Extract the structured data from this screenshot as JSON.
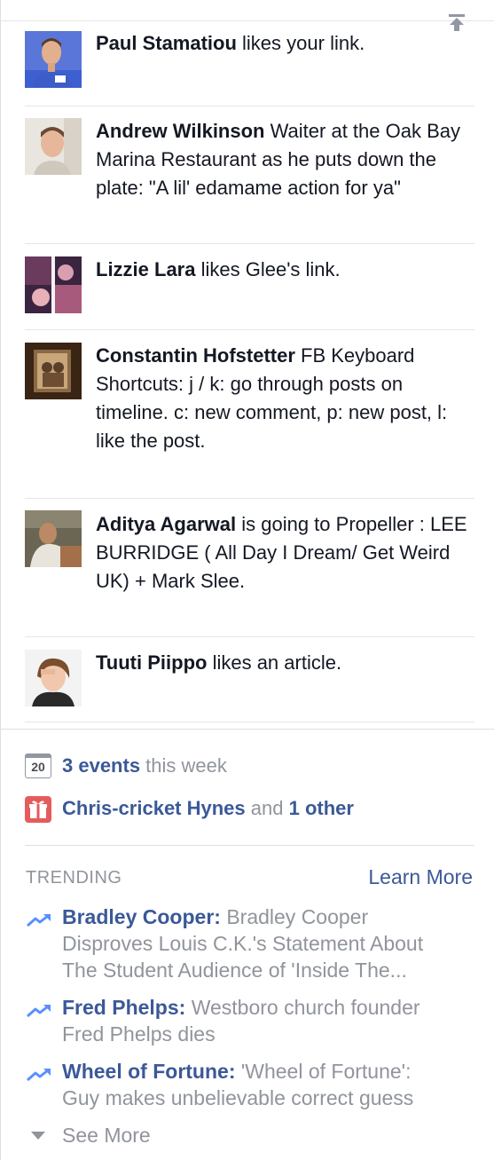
{
  "ticker": {
    "stories": [
      {
        "name": "Paul Stamatiou",
        "text": " likes your link."
      },
      {
        "name": "Andrew Wilkinson",
        "text": " Waiter at the Oak Bay Marina Restaurant as he puts down the plate: \"A lil' edamame action for ya\""
      },
      {
        "name": "Lizzie Lara",
        "text": " likes Glee's link."
      },
      {
        "name": "Constantin Hofstetter",
        "text": " FB Keyboard Shortcuts: j / k: go through posts on timeline. c: new comment, p: new post, l: like the post."
      },
      {
        "name": "Aditya Agarwal",
        "text": " is going to Propeller : LEE BURRIDGE ( All Day I Dream/ Get Weird UK) + Mark Slee."
      },
      {
        "name": "Tuuti Piippo",
        "text": " likes an article."
      }
    ]
  },
  "reminders": {
    "events": {
      "calendar_day": "20",
      "count": "3 events",
      "suffix": " this week"
    },
    "birthday": {
      "name": "Chris-cricket Hynes",
      "and": " and ",
      "other": "1 other"
    }
  },
  "trending": {
    "title": "TRENDING",
    "learn_more": "Learn More",
    "items": [
      {
        "topic": "Bradley Cooper:",
        "text": " Bradley Cooper Disproves Louis C.K.'s Statement About The Student Audience of 'Inside The..."
      },
      {
        "topic": "Fred Phelps:",
        "text": " Westboro church founder Fred Phelps dies"
      },
      {
        "topic": "Wheel of Fortune:",
        "text": " 'Wheel of Fortune': Guy makes unbelievable correct guess"
      }
    ],
    "see_more": "See More"
  },
  "colors": {
    "link": "#3b5998",
    "muted": "#90949c",
    "text": "#141823",
    "trend_arrow": "#5890ff"
  }
}
